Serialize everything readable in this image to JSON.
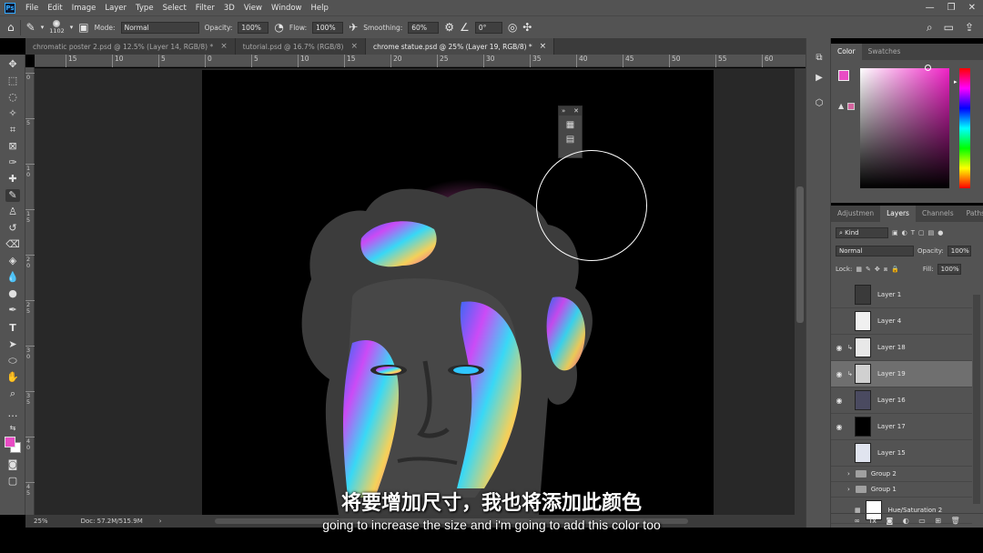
{
  "app": {
    "logo": "Ps",
    "menus": [
      "File",
      "Edit",
      "Image",
      "Layer",
      "Type",
      "Select",
      "Filter",
      "3D",
      "View",
      "Window",
      "Help"
    ],
    "window_controls": [
      "minimize-icon",
      "restore-icon",
      "close-icon"
    ]
  },
  "options": {
    "brush_size": "1102",
    "mode_label": "Mode:",
    "mode_value": "Normal",
    "opacity_label": "Opacity:",
    "opacity_value": "100%",
    "flow_label": "Flow:",
    "flow_value": "100%",
    "smoothing_label": "Smoothing:",
    "smoothing_value": "60%",
    "angle_value": "0°"
  },
  "tabs": [
    {
      "label": "chromatic poster 2.psd @ 12.5% (Layer 14, RGB/8) *",
      "active": false
    },
    {
      "label": "tutorial.psd @ 16.7% (RGB/8)",
      "active": false
    },
    {
      "label": "chrome statue.psd @ 25% (Layer 19, RGB/8) *",
      "active": true
    }
  ],
  "ruler_top": [
    "15",
    "10",
    "5",
    "0",
    "5",
    "10",
    "15",
    "20",
    "25",
    "30",
    "35",
    "40",
    "45",
    "50",
    "55",
    "60"
  ],
  "ruler_left": [
    "0",
    "5",
    "1\n0",
    "1\n5",
    "2\n0",
    "2\n5",
    "3\n0",
    "3\n5",
    "4\n0",
    "4\n5"
  ],
  "status": {
    "zoom": "25%",
    "doc": "Doc: 57.2M/515.9M"
  },
  "color_panel": {
    "tabs": [
      "Color",
      "Swatches"
    ],
    "foreground": "#e84cc4",
    "background": "#ffffff"
  },
  "layers_panel": {
    "tabs": [
      "Adjustmen",
      "Layers",
      "Channels",
      "Paths"
    ],
    "filter_kind": "Kind",
    "blend_mode": "Normal",
    "opacity_label": "Opacity:",
    "opacity_value": "100%",
    "lock_label": "Lock:",
    "fill_label": "Fill:",
    "fill_value": "100%",
    "layers": [
      {
        "name": "Layer 1",
        "visible": false,
        "selected": false,
        "clip": false,
        "thumb": "#3a3a3a",
        "kind": "layer"
      },
      {
        "name": "Layer 4",
        "visible": false,
        "selected": false,
        "clip": false,
        "thumb": "#f0f0f0",
        "kind": "layer"
      },
      {
        "name": "Layer 18",
        "visible": true,
        "selected": false,
        "clip": true,
        "thumb": "#e8e8e8",
        "kind": "layer"
      },
      {
        "name": "Layer 19",
        "visible": true,
        "selected": true,
        "clip": true,
        "thumb": "#d0d0d0",
        "kind": "layer"
      },
      {
        "name": "Layer 16",
        "visible": true,
        "selected": false,
        "clip": false,
        "thumb": "#4a4a60",
        "kind": "layer"
      },
      {
        "name": "Layer 17",
        "visible": true,
        "selected": false,
        "clip": false,
        "thumb": "#000000",
        "kind": "layer"
      },
      {
        "name": "Layer 15",
        "visible": false,
        "selected": false,
        "clip": false,
        "thumb": "#e0e4ef",
        "kind": "layer"
      },
      {
        "name": "Group 2",
        "visible": false,
        "selected": false,
        "clip": false,
        "kind": "group"
      },
      {
        "name": "Group 1",
        "visible": false,
        "selected": false,
        "clip": false,
        "kind": "group"
      },
      {
        "name": "Hue/Saturation 2",
        "visible": false,
        "selected": false,
        "clip": false,
        "thumb": "#ffffff",
        "kind": "adjustment"
      }
    ]
  },
  "subtitles": {
    "zh": "将要增加尺寸，我也将添加此颜色",
    "en": "going to increase the size and i'm going to add this color too"
  }
}
